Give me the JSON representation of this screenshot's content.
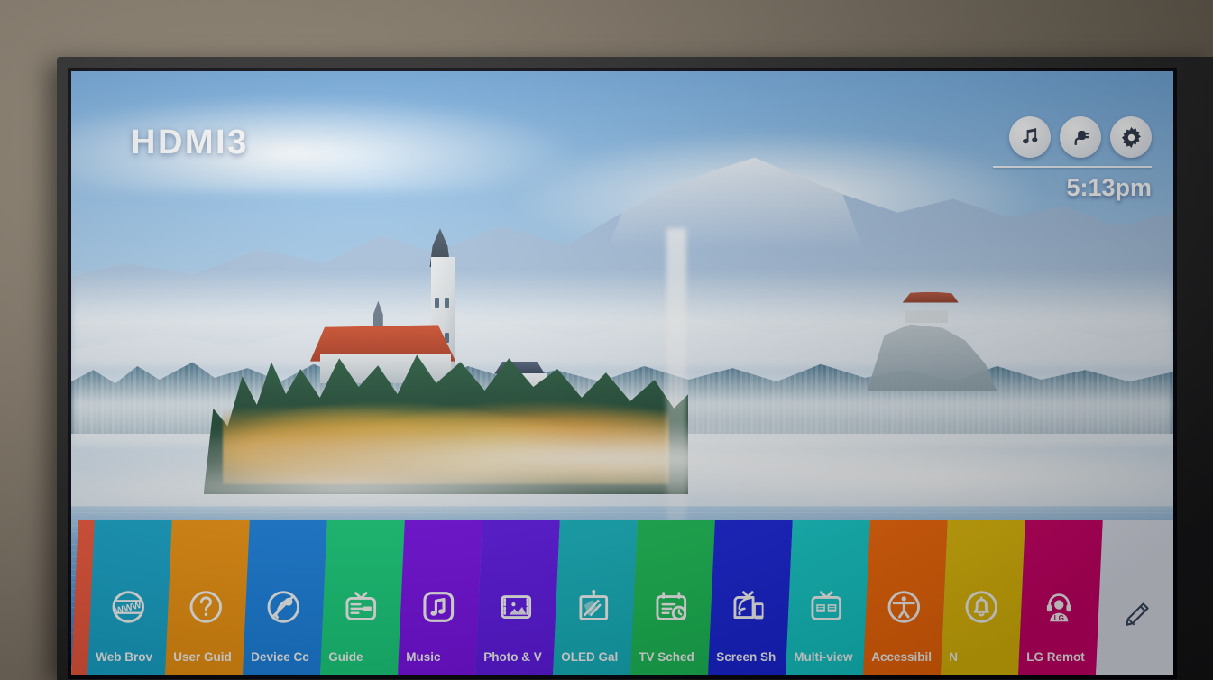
{
  "device": {
    "screen_label": "HDMI3"
  },
  "status_bar": {
    "clock": "5:13pm",
    "icons": [
      {
        "name": "music-icon",
        "label": "Music"
      },
      {
        "name": "input-plug-icon",
        "label": "Inputs"
      },
      {
        "name": "gear-icon",
        "label": "Settings"
      }
    ]
  },
  "launcher": {
    "tiles": [
      {
        "label": "",
        "color": "#f4573b",
        "icon": "partial-tile",
        "partial": true
      },
      {
        "label": "Web Brov",
        "full_label": "Web Browser",
        "color": "#13aad2",
        "icon": "www-globe-icon"
      },
      {
        "label": "User Guid",
        "full_label": "User Guide",
        "color": "#f5960d",
        "icon": "question-mark-icon"
      },
      {
        "label": "Device Cc",
        "full_label": "Device Connector",
        "color": "#1784e8",
        "icon": "device-connector-icon"
      },
      {
        "label": "Guide",
        "full_label": "Guide",
        "color": "#15d57f",
        "icon": "tv-guide-icon"
      },
      {
        "label": "Music",
        "full_label": "Music",
        "color": "#7b0df0",
        "icon": "music-note-icon"
      },
      {
        "label": "Photo & V",
        "full_label": "Photo & Video",
        "color": "#6016ef",
        "icon": "photo-video-icon"
      },
      {
        "label": "OLED Gal",
        "full_label": "OLED Gallery",
        "color": "#12b7c4",
        "icon": "oled-gallery-icon"
      },
      {
        "label": "TV Sched",
        "full_label": "TV Scheduler",
        "color": "#19c257",
        "icon": "tv-scheduler-icon"
      },
      {
        "label": "Screen Sh",
        "full_label": "Screen Share",
        "color": "#1623e0",
        "icon": "screen-share-icon"
      },
      {
        "label": "Multi-view",
        "full_label": "Multi-view",
        "color": "#12cfcf",
        "icon": "multi-view-icon"
      },
      {
        "label": "Accessibil",
        "full_label": "Accessibility",
        "color": "#fa6a07",
        "icon": "accessibility-icon"
      },
      {
        "label": "N",
        "full_label": "Notifications",
        "color": "#e8c009",
        "icon": "bell-icon"
      },
      {
        "label": "LG Remot",
        "full_label": "LG Remote Service",
        "color": "#d4006b",
        "icon": "lg-support-agent-icon"
      },
      {
        "label": "",
        "full_label": "Edit",
        "color": "#e6e9f5",
        "icon": "pencil-edit-icon"
      }
    ]
  }
}
